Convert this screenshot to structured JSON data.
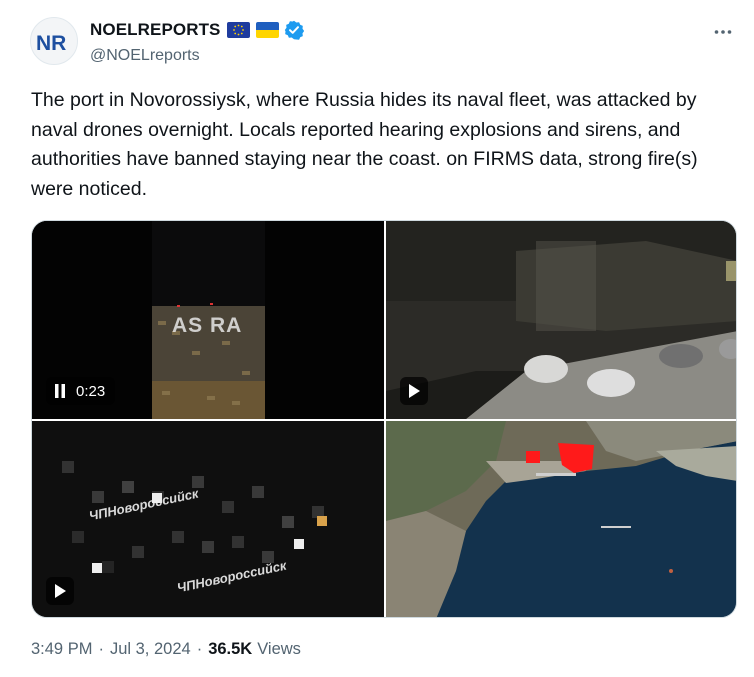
{
  "author": {
    "avatar_text": "NR",
    "display_name": "NOELREPORTS",
    "handle": "@NOELreports",
    "flags": [
      "eu-flag-icon",
      "ukraine-flag-icon"
    ],
    "verified": true
  },
  "tweet": {
    "text": "The port in Novorossiysk, where Russia hides its naval fleet, was attacked by naval drones overnight. Locals reported hearing explosions and sirens, and authorities have banned staying near the coast. on FIRMS data, strong fire(s) were noticed."
  },
  "media": {
    "video1": {
      "watermark": "AS RA",
      "duration": "0:23"
    },
    "video3": {
      "watermark_1": "ЧПНовороссийск",
      "watermark_2": "ЧПНовороссийск"
    }
  },
  "footer": {
    "time": "3:49 PM",
    "date": "Jul 3, 2024",
    "separator": "·",
    "views_count": "36.5K",
    "views_label": "Views"
  },
  "colors": {
    "text": "#0f1419",
    "secondary": "#536471",
    "verified": "#1d9bf0",
    "fire": "#ff1a1a"
  }
}
